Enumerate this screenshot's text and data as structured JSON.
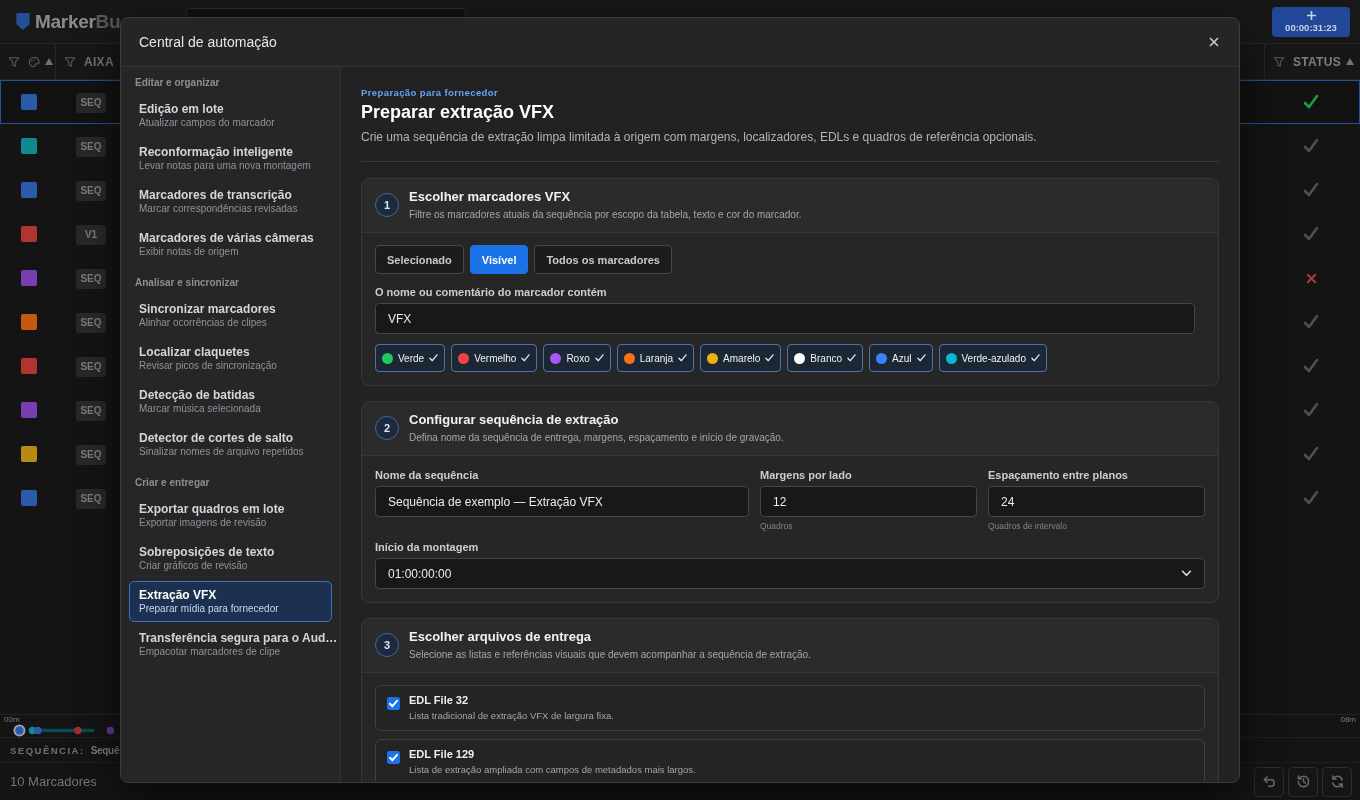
{
  "app": {
    "logo": {
      "primary": "Marker",
      "secondary": "Bu"
    },
    "timer": "00:00:31:23"
  },
  "table": {
    "columns": [
      {
        "kind": "color",
        "sorted": true
      },
      {
        "kind": "text",
        "label": "AIXA",
        "sorted": false
      },
      {
        "kind": "status",
        "label": "STATUS",
        "sorted": true
      }
    ],
    "rows": [
      {
        "color": "#2b5aab",
        "tag": "SEQ",
        "kind": "done",
        "selected": true
      },
      {
        "color": "#0e8a93",
        "tag": "SEQ",
        "kind": "open",
        "selected": false
      },
      {
        "color": "#2b5aab",
        "tag": "SEQ",
        "kind": "open",
        "selected": false
      },
      {
        "color": "#b3332f",
        "tag": "V1",
        "kind": "open",
        "selected": false
      },
      {
        "color": "#7b3db4",
        "tag": "SEQ",
        "kind": "error",
        "selected": false
      },
      {
        "color": "#c45a12",
        "tag": "SEQ",
        "kind": "open",
        "selected": false
      },
      {
        "color": "#b3332f",
        "tag": "SEQ",
        "kind": "open",
        "selected": false
      },
      {
        "color": "#7b3db4",
        "tag": "SEQ",
        "kind": "open",
        "selected": false
      },
      {
        "color": "#b58b12",
        "tag": "SEQ",
        "kind": "open",
        "selected": false
      },
      {
        "color": "#2b5aab",
        "tag": "SEQ",
        "kind": "open",
        "selected": false
      }
    ]
  },
  "timeline": {
    "start": "00m",
    "end": "08m"
  },
  "sequence": {
    "label": "SEQUÊNCIA:",
    "value": "Sequê"
  },
  "footer": {
    "count": "10 Marcadores",
    "buttons": [
      {
        "kind": "undo"
      },
      {
        "kind": "history"
      },
      {
        "kind": "refresh"
      }
    ]
  },
  "modal": {
    "title": "Central de automação",
    "sidebar": {
      "groups": [
        {
          "title": "Editar e organizar",
          "items": [
            {
              "title": "Edição em lote",
              "subtitle": "Atualizar campos do marcador",
              "selected": false
            },
            {
              "title": "Reconformação inteligente",
              "subtitle": "Levar notas para uma nova montagem",
              "selected": false
            },
            {
              "title": "Marcadores de transcrição",
              "subtitle": "Marcar correspondências revisadas",
              "selected": false
            },
            {
              "title": "Marcadores de várias câmeras",
              "subtitle": "Exibir notas de origem",
              "selected": false
            }
          ]
        },
        {
          "title": "Analisar e sincronizar",
          "items": [
            {
              "title": "Sincronizar marcadores",
              "subtitle": "Alinhar ocorrências de clipes",
              "selected": false
            },
            {
              "title": "Localizar claquetes",
              "subtitle": "Revisar picos de sincronização",
              "selected": false
            },
            {
              "title": "Detecção de batidas",
              "subtitle": "Marcar música selecionada",
              "selected": false
            },
            {
              "title": "Detector de cortes de salto",
              "subtitle": "Sinalizar nomes de arquivo repetidos",
              "selected": false
            }
          ]
        },
        {
          "title": "Criar e entregar",
          "items": [
            {
              "title": "Exportar quadros em lote",
              "subtitle": "Exportar imagens de revisão",
              "selected": false
            },
            {
              "title": "Sobreposições de texto",
              "subtitle": "Criar gráficos de revisão",
              "selected": false
            },
            {
              "title": "Extração VFX",
              "subtitle": "Preparar mídia para fornecedor",
              "selected": true
            },
            {
              "title": "Transferência segura para o Aud…",
              "subtitle": "Empacotar marcadores de clipe",
              "selected": false
            }
          ]
        }
      ]
    },
    "page": {
      "kicker": "Preparação para fornecedor",
      "title": "Preparar extração VFX",
      "description": "Crie uma sequência de extração limpa limitada à origem com margens, localizadores, EDLs e quadros de referência opcionais.",
      "steps": [
        {
          "kind": "filter",
          "number": "1",
          "title": "Escolher marcadores VFX",
          "subtitle": "Filtre os marcadores atuais da sequência por escopo da tabela, texto e cor do marcador.",
          "scopes": [
            {
              "label": "Selecionado",
              "selected": false
            },
            {
              "label": "Visível",
              "selected": true
            },
            {
              "label": "Todos os marcadores",
              "selected": false
            }
          ],
          "search": {
            "label": "O nome ou comentário do marcador contém",
            "value": "VFX"
          },
          "colors": [
            {
              "label": "Verde",
              "color": "#22c55e",
              "selected": true
            },
            {
              "label": "Vermelho",
              "color": "#ef4444",
              "selected": true
            },
            {
              "label": "Roxo",
              "color": "#a855f7",
              "selected": true
            },
            {
              "label": "Laranja",
              "color": "#f97316",
              "selected": true
            },
            {
              "label": "Amarelo",
              "color": "#eab308",
              "selected": true
            },
            {
              "label": "Branco",
              "color": "#ffffff",
              "selected": true
            },
            {
              "label": "Azul",
              "color": "#3b82f6",
              "selected": true
            },
            {
              "label": "Verde-azulado",
              "color": "#06b6d4",
              "selected": true
            }
          ]
        },
        {
          "kind": "settings",
          "number": "2",
          "title": "Configurar sequência de extração",
          "subtitle": "Defina nome da sequência de entrega, margens, espaçamento e início de gravação.",
          "fields": [
            {
              "kind": "text",
              "label": "Nome da sequência",
              "value": "Sequência de exemplo — Extração VFX"
            },
            {
              "kind": "number",
              "label": "Margens por lado",
              "value": "12",
              "hint": "Quadros"
            },
            {
              "kind": "number",
              "label": "Espaçamento entre planos",
              "value": "24",
              "hint": "Quadros de intervalo"
            },
            {
              "kind": "select",
              "label": "Início da montagem",
              "value": "01:00:00:00"
            }
          ]
        },
        {
          "kind": "files",
          "number": "3",
          "title": "Escolher arquivos de entrega",
          "subtitle": "Selecione as listas e referências visuais que devem acompanhar a sequência de extração.",
          "options": [
            {
              "title": "EDL File 32",
              "description": "Lista tradicional de extração VFX de largura fixa.",
              "checked": true
            },
            {
              "title": "EDL File 129",
              "description": "Lista de extração ampliada com campos de metadados mais largos.",
              "checked": true
            }
          ]
        }
      ]
    }
  }
}
